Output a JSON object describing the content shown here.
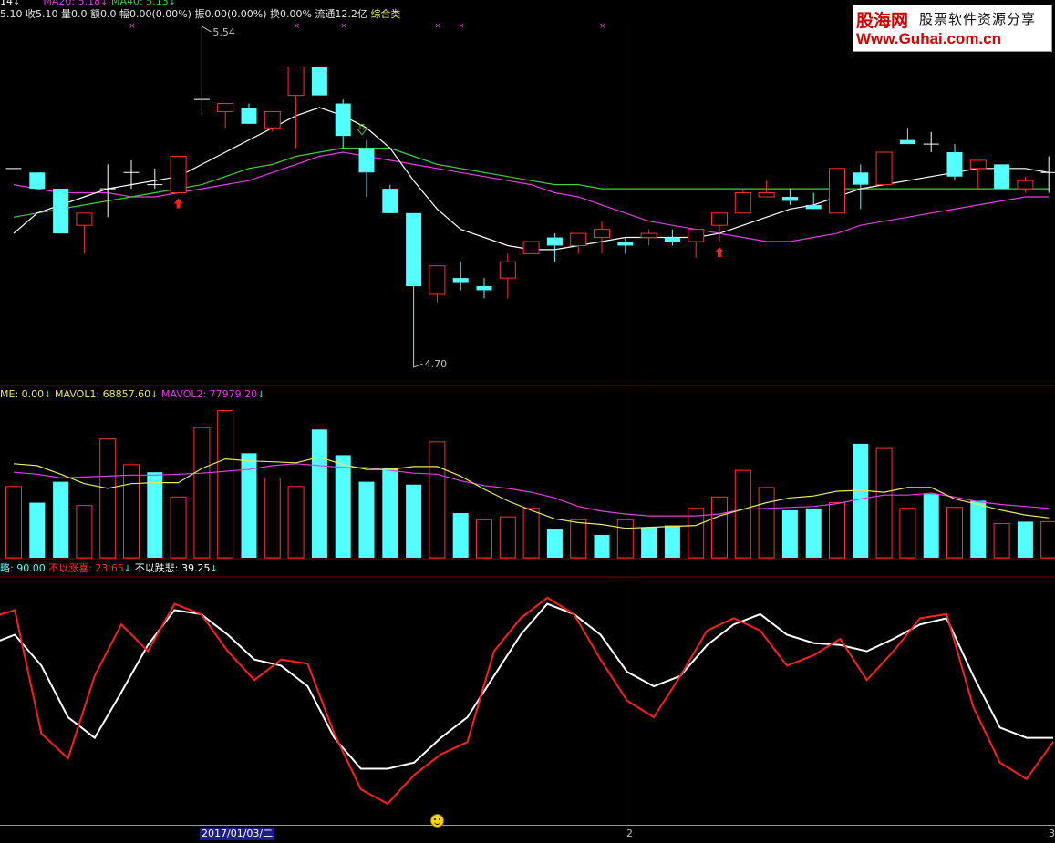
{
  "main_header": {
    "ma_partial": "14",
    "ma20_label": "MA20: 5.18",
    "ma40_label": "MA40: 5.13",
    "quote_text": "5.10 收5.10 量0.0 额0.0 幅0.00(0.00%) 振0.00(0.00%) 换0.00% 流通12.2亿",
    "sector": "综合类"
  },
  "price_annotations": {
    "high": "5.54",
    "low": "4.70"
  },
  "volume_header": {
    "vol_label": "ME: 0.00",
    "mavol1_label": "MAVOL1: 68857.60",
    "mavol2_label": "MAVOL2: 77979.20"
  },
  "indicator_header": {
    "i1_label": "略: 90.00",
    "i2_label": "不以涨喜: 23.65",
    "i3_label": "不以跌悲: 39.25"
  },
  "logo": {
    "brand": "股海网",
    "tagline": "股票软件资源分享",
    "url": "Www.Guhai.com.cn"
  },
  "datebar": {
    "date": "2017/01/03/二",
    "tick_2": "2",
    "tick_3": "3"
  },
  "colors": {
    "up": "#ff3030",
    "down": "#54ffff",
    "ma_white": "#ffffff",
    "ma_green": "#3fcf3f",
    "ma_magenta": "#e040e0",
    "mavol1": "#e8e860",
    "mavol2": "#e040e0",
    "ind_red": "#ff2020",
    "ind_white": "#ffffff",
    "grid": "#7a0000"
  },
  "chart_data": [
    {
      "type": "candlestick",
      "title": "",
      "x": [
        1,
        2,
        3,
        4,
        5,
        6,
        7,
        8,
        9,
        10,
        11,
        12,
        13,
        14,
        15,
        16,
        17,
        18,
        19,
        20,
        21,
        22,
        23,
        24,
        25,
        26,
        27,
        28,
        29,
        30,
        31,
        32,
        33,
        34,
        35,
        36,
        37,
        38,
        39,
        40,
        41,
        42,
        43,
        44,
        45
      ],
      "ohlc": [
        [
          5.19,
          5.19,
          5.19,
          5.19
        ],
        [
          5.18,
          5.18,
          5.14,
          5.14
        ],
        [
          5.14,
          5.14,
          5.03,
          5.03
        ],
        [
          5.05,
          5.08,
          4.98,
          5.08
        ],
        [
          5.14,
          5.2,
          5.07,
          5.14
        ],
        [
          5.18,
          5.21,
          5.14,
          5.18
        ],
        [
          5.15,
          5.19,
          5.14,
          5.15
        ],
        [
          5.13,
          5.22,
          5.13,
          5.22
        ],
        [
          5.36,
          5.54,
          5.32,
          5.36
        ],
        [
          5.33,
          5.35,
          5.29,
          5.35
        ],
        [
          5.34,
          5.35,
          5.3,
          5.3
        ],
        [
          5.29,
          5.33,
          5.28,
          5.33
        ],
        [
          5.37,
          5.43,
          5.24,
          5.44
        ],
        [
          5.44,
          5.44,
          5.37,
          5.37
        ],
        [
          5.35,
          5.36,
          5.24,
          5.27
        ],
        [
          5.24,
          5.26,
          5.12,
          5.18
        ],
        [
          5.14,
          5.15,
          5.08,
          5.08
        ],
        [
          5.08,
          5.08,
          4.7,
          4.9
        ],
        [
          4.88,
          4.95,
          4.86,
          4.95
        ],
        [
          4.92,
          4.96,
          4.89,
          4.91
        ],
        [
          4.9,
          4.92,
          4.87,
          4.89
        ],
        [
          4.92,
          4.98,
          4.87,
          4.96
        ],
        [
          4.98,
          5.01,
          4.98,
          5.01
        ],
        [
          5.02,
          5.03,
          4.96,
          5.0
        ],
        [
          5.0,
          5.03,
          4.98,
          5.03
        ],
        [
          5.02,
          5.06,
          4.98,
          5.04
        ],
        [
          5.01,
          5.02,
          4.98,
          5.0
        ],
        [
          5.02,
          5.04,
          5.0,
          5.03
        ],
        [
          5.02,
          5.04,
          5.0,
          5.01
        ],
        [
          5.01,
          5.04,
          4.97,
          5.04
        ],
        [
          5.05,
          5.08,
          5.01,
          5.08
        ],
        [
          5.08,
          5.14,
          5.08,
          5.13
        ],
        [
          5.12,
          5.16,
          5.12,
          5.13
        ],
        [
          5.12,
          5.14,
          5.1,
          5.11
        ],
        [
          5.1,
          5.13,
          5.09,
          5.09
        ],
        [
          5.08,
          5.19,
          5.08,
          5.19
        ],
        [
          5.18,
          5.2,
          5.09,
          5.15
        ],
        [
          5.15,
          5.21,
          5.15,
          5.23
        ],
        [
          5.26,
          5.29,
          5.26,
          5.25
        ],
        [
          5.25,
          5.28,
          5.23,
          5.25
        ],
        [
          5.23,
          5.25,
          5.16,
          5.17
        ],
        [
          5.19,
          5.2,
          5.14,
          5.21
        ],
        [
          5.2,
          5.2,
          5.15,
          5.14
        ],
        [
          5.14,
          5.17,
          5.13,
          5.16
        ],
        [
          5.18,
          5.22,
          5.13,
          5.18
        ]
      ],
      "ma_white": [
        5.03,
        5.08,
        5.1,
        5.12,
        5.14,
        5.15,
        5.16,
        5.17,
        5.2,
        5.23,
        5.26,
        5.29,
        5.32,
        5.34,
        5.32,
        5.29,
        5.24,
        5.16,
        5.09,
        5.04,
        5.02,
        5.0,
        4.99,
        4.99,
        5.0,
        5.01,
        5.02,
        5.02,
        5.02,
        5.02,
        5.03,
        5.05,
        5.07,
        5.09,
        5.1,
        5.12,
        5.14,
        5.15,
        5.16,
        5.17,
        5.18,
        5.19,
        5.19,
        5.19,
        5.18
      ],
      "ma20": [
        5.07,
        5.08,
        5.09,
        5.1,
        5.11,
        5.12,
        5.13,
        5.14,
        5.15,
        5.17,
        5.19,
        5.2,
        5.22,
        5.23,
        5.24,
        5.24,
        5.24,
        5.22,
        5.2,
        5.19,
        5.18,
        5.17,
        5.16,
        5.15,
        5.15,
        5.14,
        5.14,
        5.14,
        5.14,
        5.14,
        5.14,
        5.14,
        5.14,
        5.14,
        5.14,
        5.14,
        5.14,
        5.14,
        5.14,
        5.14,
        5.14,
        5.14,
        5.14,
        5.14,
        5.14
      ],
      "ma40": [
        5.15,
        5.14,
        5.13,
        5.13,
        5.13,
        5.12,
        5.12,
        5.13,
        5.14,
        5.15,
        5.16,
        5.18,
        5.2,
        5.22,
        5.23,
        5.22,
        5.21,
        5.2,
        5.19,
        5.18,
        5.17,
        5.16,
        5.15,
        5.13,
        5.12,
        5.1,
        5.08,
        5.06,
        5.05,
        5.04,
        5.03,
        5.02,
        5.01,
        5.01,
        5.02,
        5.03,
        5.05,
        5.06,
        5.07,
        5.08,
        5.09,
        5.1,
        5.11,
        5.12,
        5.12
      ],
      "buy_markers_x": [
        8,
        31
      ],
      "sell_markers_x": [
        16
      ],
      "ylim": [
        4.68,
        5.56
      ]
    },
    {
      "type": "bar",
      "title": "",
      "x": [
        1,
        2,
        3,
        4,
        5,
        6,
        7,
        8,
        9,
        10,
        11,
        12,
        13,
        14,
        15,
        16,
        17,
        18,
        19,
        20,
        21,
        22,
        23,
        24,
        25,
        26,
        27,
        28,
        29,
        30,
        31,
        32,
        33,
        34,
        35,
        36,
        37,
        38,
        39,
        40,
        41,
        42,
        43,
        44,
        45
      ],
      "values": [
        75,
        58,
        80,
        55,
        125,
        98,
        90,
        64,
        137,
        155,
        110,
        84,
        75,
        135,
        108,
        80,
        94,
        77,
        122,
        47,
        40,
        43,
        52,
        30,
        40,
        24,
        40,
        32,
        34,
        52,
        64,
        92,
        74,
        50,
        52,
        58,
        120,
        115,
        52,
        67,
        53,
        60,
        36,
        38,
        38
      ],
      "up_days": [
        true,
        false,
        false,
        true,
        true,
        true,
        false,
        true,
        true,
        true,
        false,
        true,
        true,
        false,
        false,
        false,
        false,
        false,
        true,
        false,
        true,
        true,
        true,
        false,
        true,
        false,
        true,
        false,
        false,
        true,
        true,
        true,
        true,
        false,
        false,
        true,
        false,
        true,
        true,
        false,
        true,
        false,
        true,
        false,
        true
      ],
      "mavol1": [
        99,
        97,
        88,
        78,
        73,
        78,
        79,
        79,
        94,
        104,
        102,
        101,
        100,
        106,
        98,
        93,
        93,
        96,
        96,
        86,
        72,
        60,
        50,
        41,
        37,
        35,
        31,
        32,
        33,
        34,
        44,
        51,
        58,
        63,
        65,
        70,
        71,
        69,
        74,
        74,
        62,
        56,
        50,
        45,
        42
      ],
      "mavol2": [
        90,
        88,
        84,
        85,
        86,
        87,
        87,
        88,
        89,
        91,
        93,
        97,
        99,
        97,
        95,
        95,
        92,
        89,
        88,
        81,
        76,
        73,
        69,
        63,
        54,
        49,
        46,
        44,
        44,
        44,
        46,
        51,
        52,
        53,
        54,
        57,
        62,
        66,
        66,
        68,
        64,
        59,
        56,
        54,
        52
      ],
      "ylim": [
        0,
        165
      ]
    },
    {
      "type": "line",
      "title": "",
      "x": [
        1,
        2,
        3,
        4,
        5,
        6,
        7,
        8,
        9,
        10,
        11,
        12,
        13,
        14,
        15,
        16,
        17,
        18,
        19,
        20,
        21,
        22,
        23,
        24,
        25,
        26,
        27,
        28,
        29,
        30,
        31,
        32,
        33,
        34,
        35,
        36,
        37,
        38,
        39,
        40,
        41,
        42,
        43,
        44,
        45
      ],
      "series": [
        {
          "name": "不以涨喜",
          "values": [
            88,
            92,
            32,
            20,
            60,
            85,
            72,
            95,
            90,
            72,
            58,
            68,
            66,
            32,
            5,
            -2,
            12,
            22,
            28,
            72,
            88,
            98,
            90,
            68,
            48,
            40,
            60,
            82,
            88,
            82,
            65,
            70,
            78,
            58,
            72,
            88,
            90,
            45,
            18,
            10,
            28
          ]
        },
        {
          "name": "不以跌悲",
          "values": [
            75,
            80,
            65,
            40,
            30,
            52,
            75,
            92,
            90,
            80,
            68,
            65,
            55,
            30,
            15,
            15,
            18,
            30,
            40,
            60,
            80,
            95,
            90,
            80,
            62,
            55,
            60,
            75,
            85,
            90,
            80,
            76,
            75,
            72,
            78,
            85,
            88,
            60,
            35,
            30,
            30
          ]
        }
      ],
      "ylim": [
        -10,
        105
      ]
    }
  ]
}
